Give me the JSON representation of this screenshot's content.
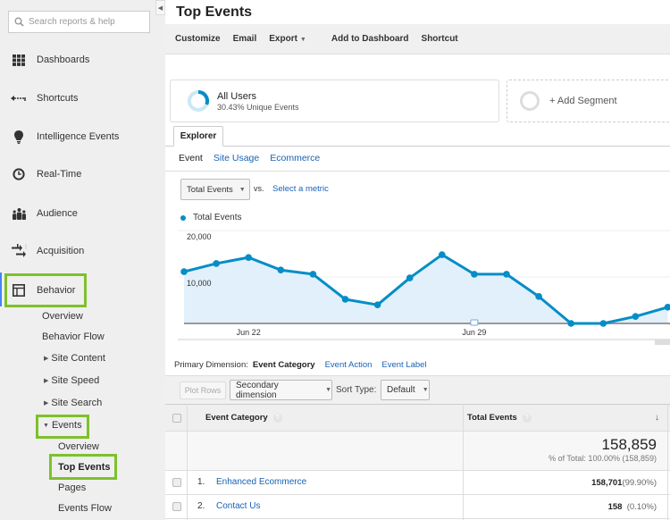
{
  "sidebar": {
    "search_placeholder": "Search reports & help",
    "nav": [
      {
        "label": "Dashboards",
        "icon": "grid-icon"
      },
      {
        "label": "Shortcuts",
        "icon": "shortcut-arrow-icon"
      },
      {
        "label": "Intelligence Events",
        "icon": "lightbulb-icon"
      },
      {
        "label": "Real-Time",
        "icon": "clock-icon"
      },
      {
        "label": "Audience",
        "icon": "people-icon"
      },
      {
        "label": "Acquisition",
        "icon": "arrows-icon"
      },
      {
        "label": "Behavior",
        "icon": "layout-icon"
      }
    ],
    "behavior_sub": [
      "Overview",
      "Behavior Flow",
      "Site Content",
      "Site Speed",
      "Site Search",
      "Events"
    ],
    "events_sub": [
      "Overview",
      "Top Events",
      "Pages",
      "Events Flow"
    ]
  },
  "header": {
    "title": "Top Events",
    "toolbar": {
      "customize": "Customize",
      "email": "Email",
      "export": "Export",
      "add_to_dashboard": "Add to Dashboard",
      "shortcut": "Shortcut"
    }
  },
  "segments": {
    "primary": {
      "name": "All Users",
      "detail": "30.43% Unique Events",
      "percent": 30.43
    },
    "add": "+ Add Segment"
  },
  "explorer": {
    "tab": "Explorer",
    "subtabs": {
      "current": "Event",
      "links": [
        "Site Usage",
        "Ecommerce"
      ]
    },
    "metric": "Total Events",
    "vs": "vs.",
    "select_metric": "Select a metric",
    "legend": "Total Events"
  },
  "chart_data": {
    "type": "line",
    "title": "",
    "series": [
      {
        "name": "Total Events",
        "color": "#058dc7",
        "values": [
          11150,
          12900,
          14200,
          11500,
          10600,
          5200,
          4000,
          9800,
          14800,
          10600,
          10600,
          5800,
          0,
          0,
          1500,
          3500
        ]
      }
    ],
    "x_tick_labels": [
      {
        "label": "Jun 22",
        "index": 2
      },
      {
        "label": "Jun 29",
        "index": 9
      }
    ],
    "y_tick_labels": [
      "10,000",
      "20,000"
    ],
    "ylim": [
      0,
      20000
    ],
    "grid": true,
    "annotation_marker_index": 9
  },
  "table": {
    "primary_dimension_label": "Primary Dimension:",
    "dimensions": {
      "current": "Event Category",
      "links": [
        "Event Action",
        "Event Label"
      ]
    },
    "plot_rows": "Plot Rows",
    "secondary_dimension": "Secondary dimension",
    "sort_type_label": "Sort Type:",
    "sort_type": "Default",
    "columns": [
      "Event Category",
      "Total Events"
    ],
    "totals": {
      "value": "158,859",
      "detail": "% of Total: 100.00% (158,859)"
    },
    "rows": [
      {
        "index": "1.",
        "category": "Enhanced Ecommerce",
        "total": "158,701",
        "pct": "(99.90%)"
      },
      {
        "index": "2.",
        "category": "Contact Us",
        "total": "158",
        "pct": "(0.10%)"
      }
    ]
  },
  "colors": {
    "accent_link": "#1a62b4",
    "series": "#058dc7",
    "highlight": "#7dc12b"
  }
}
